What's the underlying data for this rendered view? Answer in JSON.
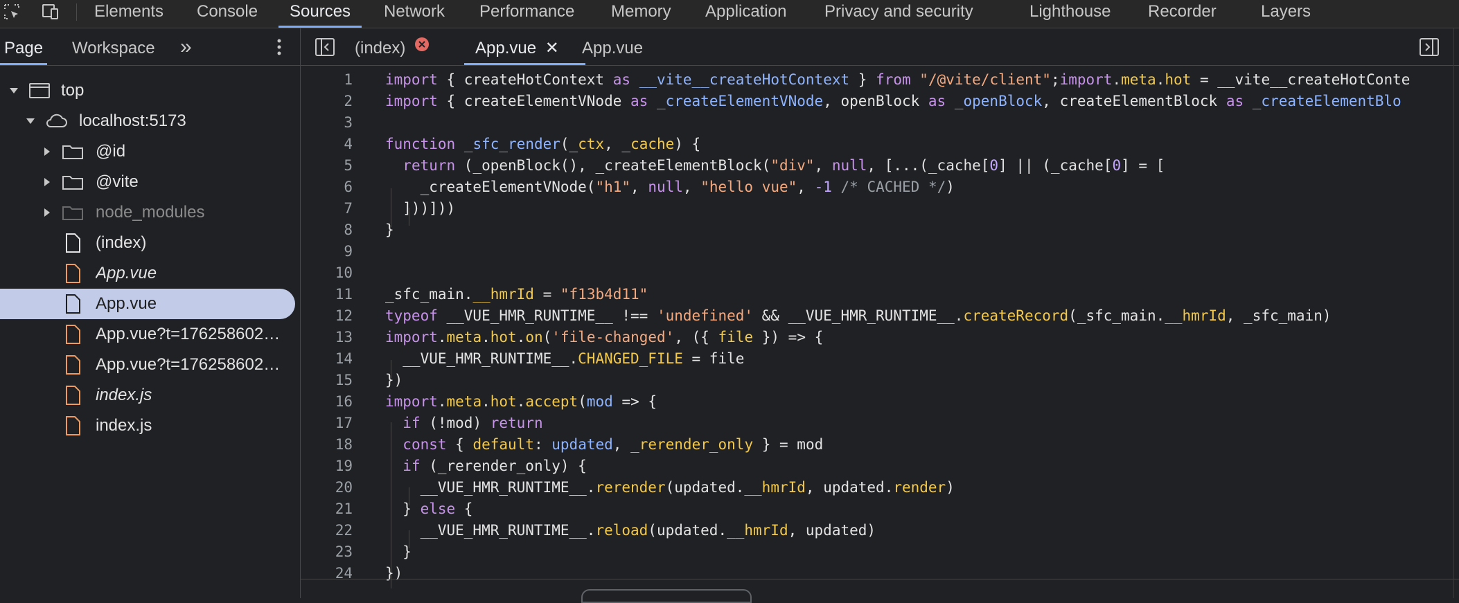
{
  "top_tabs": [
    "Elements",
    "Console",
    "Sources",
    "Network",
    "Performance",
    "Memory",
    "Application",
    "Privacy and security",
    "Lighthouse",
    "Recorder",
    "Layers"
  ],
  "top_active": "Sources",
  "left_panel": {
    "tabs": [
      "Page",
      "Workspace"
    ],
    "more": "»",
    "tree": [
      {
        "label": "top"
      },
      {
        "label": "localhost:5173"
      },
      {
        "label": "@id"
      },
      {
        "label": "@vite"
      },
      {
        "label": "node_modules"
      },
      {
        "label": "(index)"
      },
      {
        "label": "App.vue"
      },
      {
        "label": "App.vue"
      },
      {
        "label": "App.vue?t=176258602…"
      },
      {
        "label": "App.vue?t=176258602…"
      },
      {
        "label": "index.js"
      },
      {
        "label": "index.js"
      }
    ]
  },
  "editor": {
    "tabs": [
      "(index)",
      "App.vue",
      "App.vue"
    ],
    "line_numbers": [
      "1",
      "2",
      "3",
      "4",
      "5",
      "6",
      "7",
      "8",
      "9",
      "10",
      "11",
      "12",
      "13",
      "14",
      "15",
      "16",
      "17",
      "18",
      "19",
      "20",
      "21",
      "22",
      "23",
      "24"
    ]
  }
}
